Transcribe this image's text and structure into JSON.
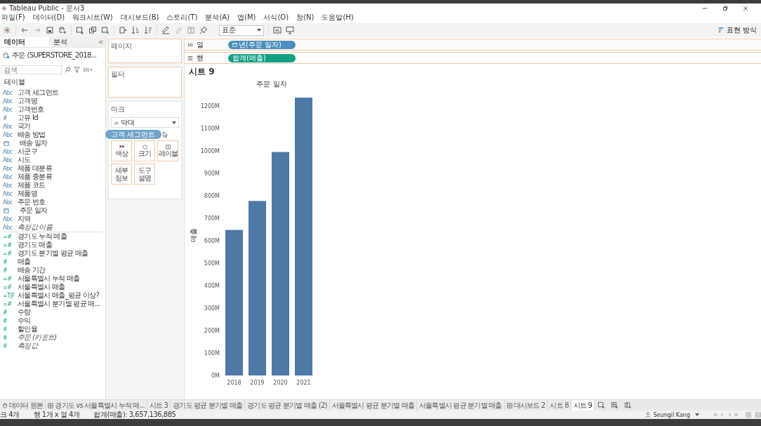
{
  "window": {
    "title": "Tableau Public - 문서3"
  },
  "menu": [
    "파일(F)",
    "데이터(D)",
    "워크시트(W)",
    "대시보드(B)",
    "스토리(T)",
    "분석(A)",
    "맵(M)",
    "서식(O)",
    "창(N)",
    "도움말(H)"
  ],
  "toolbar": {
    "fit_dropdown": "표준",
    "show_me": "표현 방식"
  },
  "data_pane": {
    "tabs": [
      {
        "label": "데이터",
        "selected": true
      },
      {
        "label": "분석",
        "selected": false
      }
    ],
    "collapse": "<",
    "datasource": "주문 (SUPERSTORE_2018...",
    "search": {
      "placeholder": "검색"
    },
    "section": "테이블",
    "fields": [
      {
        "kind": "text",
        "icon": "Abc",
        "name": "고객 세그먼트",
        "measure": false,
        "italic": false
      },
      {
        "kind": "text",
        "icon": "Abc",
        "name": "고객명",
        "measure": false,
        "italic": false
      },
      {
        "kind": "text",
        "icon": "Abc",
        "name": "고객번호",
        "measure": false,
        "italic": false
      },
      {
        "kind": "text",
        "icon": "#",
        "name": "고유 Id",
        "measure": false,
        "italic": false
      },
      {
        "kind": "text",
        "icon": "Abc",
        "name": "국가",
        "measure": false,
        "italic": false
      },
      {
        "kind": "text",
        "icon": "Abc",
        "name": "배송 방법",
        "measure": false,
        "italic": false
      },
      {
        "kind": "date",
        "name": "배송 일자",
        "measure": false,
        "italic": false
      },
      {
        "kind": "text",
        "icon": "Abc",
        "name": "시군구",
        "measure": false,
        "italic": false
      },
      {
        "kind": "text",
        "icon": "Abc",
        "name": "시도",
        "measure": false,
        "italic": false
      },
      {
        "kind": "text",
        "icon": "Abc",
        "name": "제품 대분류",
        "measure": false,
        "italic": false
      },
      {
        "kind": "text",
        "icon": "Abc",
        "name": "제품 중분류",
        "measure": false,
        "italic": false
      },
      {
        "kind": "text",
        "icon": "Abc",
        "name": "제품 코드",
        "measure": false,
        "italic": false
      },
      {
        "kind": "text",
        "icon": "Abc",
        "name": "제품명",
        "measure": false,
        "italic": false
      },
      {
        "kind": "text",
        "icon": "Abc",
        "name": "주문 번호",
        "measure": false,
        "italic": false
      },
      {
        "kind": "date",
        "name": "주문 일자",
        "measure": false,
        "italic": false
      },
      {
        "kind": "text",
        "icon": "Abc",
        "name": "지역",
        "measure": false,
        "italic": false
      },
      {
        "kind": "text",
        "icon": "Abc",
        "name": "측정값 이름",
        "measure": false,
        "italic": true
      },
      {
        "kind": "text",
        "icon": "=#",
        "name": "경기도 누적 매출",
        "measure": true,
        "italic": false
      },
      {
        "kind": "text",
        "icon": "=#",
        "name": "경기도 매출",
        "measure": true,
        "italic": false
      },
      {
        "kind": "text",
        "icon": "=#",
        "name": "경기도 분기별 평균 매출",
        "measure": true,
        "italic": false
      },
      {
        "kind": "text",
        "icon": "#",
        "name": "매출",
        "measure": true,
        "italic": false
      },
      {
        "kind": "text",
        "icon": "#",
        "name": "배송 기간",
        "measure": true,
        "italic": false
      },
      {
        "kind": "text",
        "icon": "=#",
        "name": "서울특별시 누적 매출",
        "measure": true,
        "italic": false
      },
      {
        "kind": "text",
        "icon": "=#",
        "name": "서울특별시 매출",
        "measure": true,
        "italic": false
      },
      {
        "kind": "text",
        "icon": "=T|F",
        "name": "서울특별시 매출_평균 이상?",
        "measure": true,
        "italic": false
      },
      {
        "kind": "text",
        "icon": "=#",
        "name": "서울특별시 분기별 평균 매...",
        "measure": true,
        "italic": false
      },
      {
        "kind": "text",
        "icon": "#",
        "name": "수량",
        "measure": true,
        "italic": false
      },
      {
        "kind": "text",
        "icon": "#",
        "name": "수익",
        "measure": true,
        "italic": false
      },
      {
        "kind": "text",
        "icon": "#",
        "name": "할인율",
        "measure": true,
        "italic": false
      },
      {
        "kind": "text",
        "icon": "#",
        "name": "주문 (카운트)",
        "measure": true,
        "italic": true
      },
      {
        "kind": "text",
        "icon": "#",
        "name": "측정값",
        "measure": true,
        "italic": true
      }
    ]
  },
  "cards": {
    "pages": "페이지",
    "filters": "필터",
    "marks": {
      "title": "마크",
      "mark_type": "막대",
      "buttons": [
        {
          "kind": "color",
          "label": "색상"
        },
        {
          "kind": "size",
          "label": "크기"
        },
        {
          "kind": "label",
          "label": "레이블"
        },
        {
          "kind": "detail",
          "label": "세부\n정보"
        },
        {
          "kind": "tooltip",
          "label": "도구\n설명"
        }
      ]
    },
    "dragged_pill": "고객 세그먼트"
  },
  "shelves": [
    {
      "kind": "columns",
      "label": "열",
      "pill": "년(주문 일자)",
      "color": "#4a8fbd"
    },
    {
      "kind": "rows",
      "label": "행",
      "pill": "합계(매출)",
      "color": "#13a085"
    }
  ],
  "sheet": {
    "title": "시트 9",
    "chart_data": {
      "type": "bar",
      "xlabel": "주문 일자",
      "ylabel": "매출",
      "categories": [
        "2018",
        "2019",
        "2020",
        "2021"
      ],
      "values": [
        648,
        777,
        995,
        1237
      ],
      "ylim": [
        0,
        1250
      ],
      "yticks": [
        {
          "value": 0,
          "label": "0M"
        },
        {
          "value": 100,
          "label": "100M"
        },
        {
          "value": 200,
          "label": "200M"
        },
        {
          "value": 300,
          "label": "300M"
        },
        {
          "value": 400,
          "label": "400M"
        },
        {
          "value": 500,
          "label": "500M"
        },
        {
          "value": 600,
          "label": "600M"
        },
        {
          "value": 700,
          "label": "700M"
        },
        {
          "value": 800,
          "label": "800M"
        },
        {
          "value": 900,
          "label": "900M"
        },
        {
          "value": 1000,
          "label": "1000M"
        },
        {
          "value": 1100,
          "label": "1100M"
        },
        {
          "value": 1200,
          "label": "1200M"
        }
      ]
    }
  },
  "tabs": [
    {
      "kind": "datasource",
      "label": "데이터 원본",
      "selected": false
    },
    {
      "kind": "dashboard",
      "label": "경기도 vs 서울특별시 누적 매...",
      "selected": false
    },
    {
      "kind": "sheet",
      "label": "시트 3",
      "selected": false
    },
    {
      "kind": "sheet",
      "label": "경기도 평균 분기별 매출",
      "selected": false
    },
    {
      "kind": "sheet",
      "label": "경기도 평균 분기별 매출 (2)",
      "selected": false
    },
    {
      "kind": "sheet",
      "label": "서울특별시 평균 분기별 매출",
      "selected": false
    },
    {
      "kind": "sheet",
      "label": "서울특별시 평균 분기별 매출",
      "selected": false
    },
    {
      "kind": "dashboard",
      "label": "대시보드 2",
      "selected": false
    },
    {
      "kind": "sheet",
      "label": "시트 8",
      "selected": false
    },
    {
      "kind": "sheet",
      "label": "시트 9",
      "selected": true
    }
  ],
  "status_bar": {
    "marks": "크 4개",
    "dims": "행 1개 x 열 4개",
    "sum": "합계(매출): 3,657,136,885",
    "user": "Seungil Kang"
  }
}
